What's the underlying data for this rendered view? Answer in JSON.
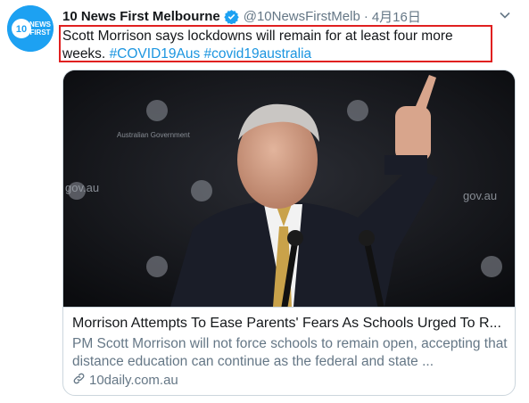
{
  "tweet": {
    "author_name": "10 News First Melbourne",
    "handle": "@10NewsFirstMelb",
    "separator": "·",
    "date": "4月16日",
    "text_main": "Scott Morrison says lockdowns will remain for at least four more weeks.",
    "hashtags": [
      "#COVID19Aus",
      "#covid19australia"
    ],
    "avatar_text": [
      "10",
      "NEWS",
      "FIRST"
    ]
  },
  "card": {
    "title": "Morrison Attempts To Ease Parents' Fears As Schools Urged To R...",
    "description": "PM Scott Morrison will not force schools to remain open, accepting that distance education can continue as the federal and state ...",
    "domain": "10daily.com.au",
    "image_text": [
      "gov.au",
      "gov.au",
      "Australian Government"
    ]
  },
  "colors": {
    "accent": "#1b95e0",
    "highlight_border": "#e02020",
    "secondary_text": "#657786",
    "verified": "#1da1f2"
  },
  "icons": {
    "verified": "verified-badge-icon",
    "caret": "chevron-down-icon",
    "link": "link-icon"
  }
}
